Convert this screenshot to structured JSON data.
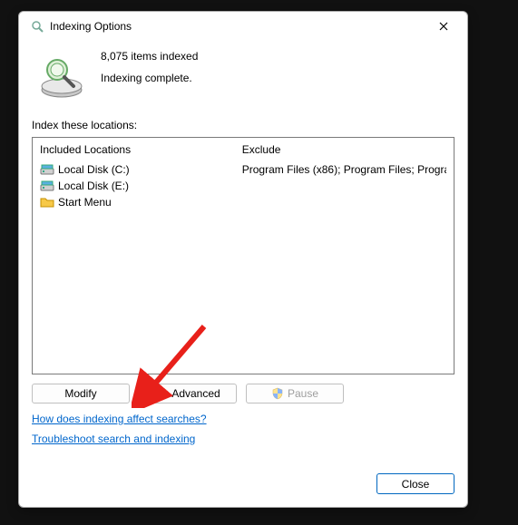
{
  "dialog": {
    "title": "Indexing Options"
  },
  "status": {
    "count_line": "8,075 items indexed",
    "status_line": "Indexing complete."
  },
  "locations_label": "Index these locations:",
  "columns": {
    "included": "Included Locations",
    "excluded": "Exclude"
  },
  "locations": [
    {
      "icon": "disk",
      "label": "Local Disk (C:)",
      "exclude": "Program Files (x86); Program Files; Progra..."
    },
    {
      "icon": "disk",
      "label": "Local Disk (E:)",
      "exclude": ""
    },
    {
      "icon": "folder",
      "label": "Start Menu",
      "exclude": ""
    }
  ],
  "buttons": {
    "modify": "Modify",
    "advanced": "Advanced",
    "pause": "Pause",
    "close": "Close"
  },
  "links": {
    "how": "How does indexing affect searches?",
    "troubleshoot": "Troubleshoot search and indexing"
  }
}
